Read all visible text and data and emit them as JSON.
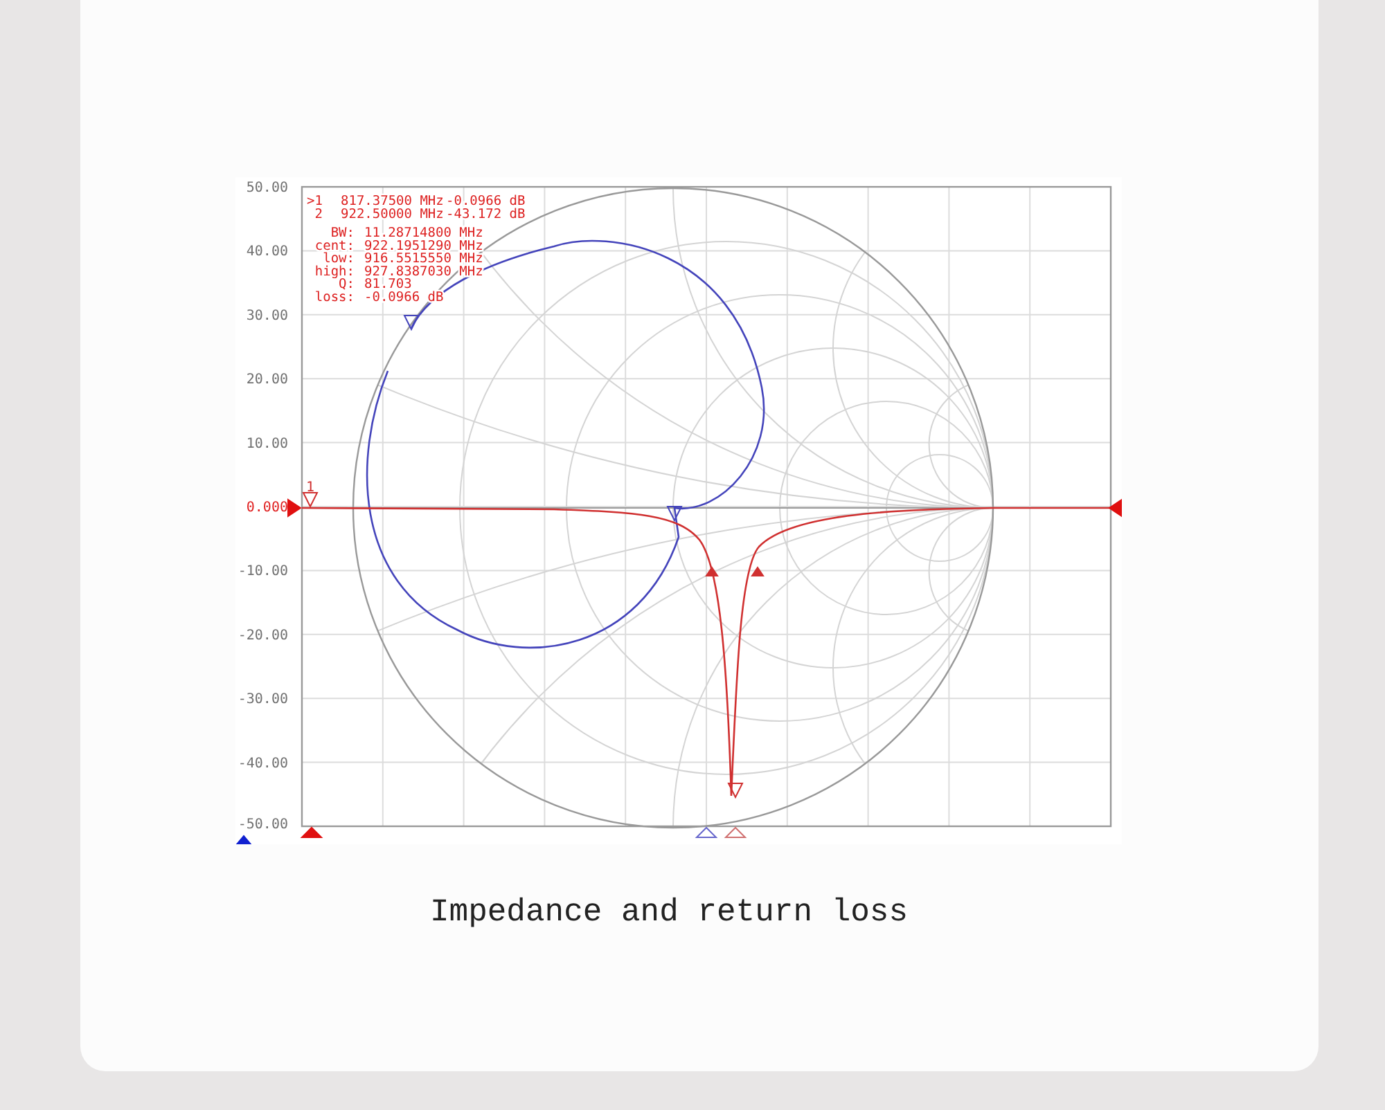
{
  "figure": {
    "y_axis_labels": [
      {
        "text": "50.00",
        "kind": "tick"
      },
      {
        "text": "40.00",
        "kind": "tick"
      },
      {
        "text": "30.00",
        "kind": "tick"
      },
      {
        "text": "20.00",
        "kind": "tick"
      },
      {
        "text": "10.00",
        "kind": "tick"
      },
      {
        "text": "0.000",
        "kind": "reference"
      },
      {
        "text": "-10.00",
        "kind": "tick"
      },
      {
        "text": "-20.00",
        "kind": "tick"
      },
      {
        "text": "-30.00",
        "kind": "tick"
      },
      {
        "text": "-40.00",
        "kind": "tick"
      },
      {
        "text": "-50.00",
        "kind": "tick"
      }
    ],
    "markers": [
      {
        "id": ">1",
        "frequency": "817.37500 MHz",
        "value": "-0.0966 dB"
      },
      {
        "id": "2",
        "frequency": "922.50000 MHz",
        "value": "-43.172 dB"
      }
    ],
    "stats": [
      {
        "label": "BW:",
        "value": "11.28714800 MHz"
      },
      {
        "label": "cent:",
        "value": "922.1951290 MHz"
      },
      {
        "label": "low:",
        "value": "916.5515550 MHz"
      },
      {
        "label": "high:",
        "value": "927.8387030 MHz"
      },
      {
        "label": "Q:",
        "value": "81.703"
      },
      {
        "label": "loss:",
        "value": "-0.0966 dB"
      }
    ],
    "reference_marker": "1",
    "caption": "Impedance and return loss"
  }
}
